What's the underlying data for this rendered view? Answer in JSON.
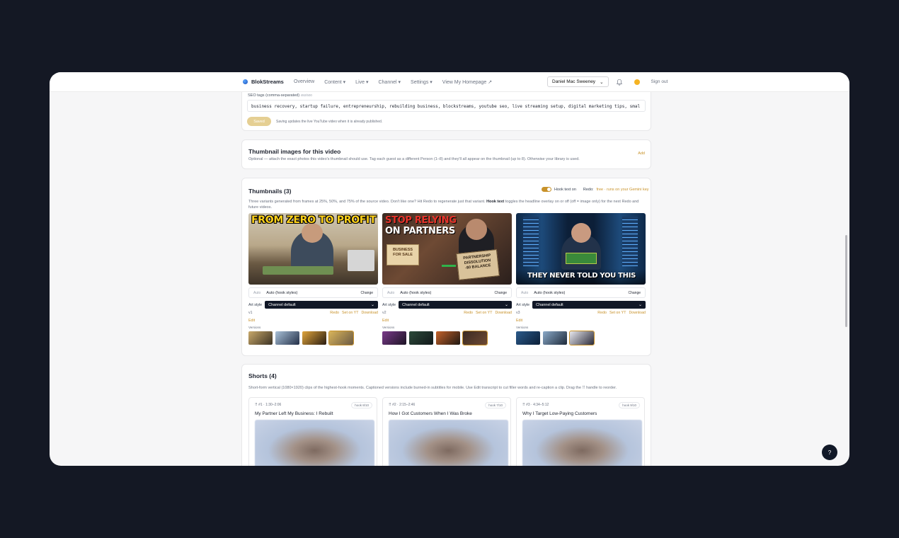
{
  "nav": {
    "brand": "BlokStreams",
    "links": [
      "Overview",
      "Content ▾",
      "Live ▾",
      "Channel ▾",
      "Settings ▾",
      "View My Homepage ↗"
    ],
    "user": "Daniel Mac Sweeney",
    "signout": "Sign out"
  },
  "seo": {
    "label": "SEO tags (comma-separated)",
    "count": "492/500",
    "value": "business recovery, startup failure, entrepreneurship, rebuilding business, blockstreams, youtube seo, live streaming setup, digital marketing tips, smal",
    "save": "Saved",
    "note": "Saving updates the live YouTube video when it is already published."
  },
  "thumbnail_images": {
    "title": "Thumbnail images for this video",
    "desc": "Optional — attach the exact photos this video's thumbnail should use. Tag each guest as a different Person (1–8) and they'll all appear on the thumbnail (up to 8). Otherwise your library is used.",
    "add": "Add"
  },
  "thumbnails": {
    "title": "Thumbnails (3)",
    "hook_toggle": "Hook text on",
    "redo_prefix": "Redo:",
    "redo_free": "free · runs on your Gemini key",
    "desc_a": "Three variants generated from frames at 25%, 50%, and 75% of the source video. Don't like one? Hit Redo to regenerate just that variant.",
    "desc_b": "Hook text",
    "desc_c": "toggles the headline overlay on or off (off = image only) for the next Redo and future videos.",
    "auto_label": "Auto",
    "auto_value": "Auto (hook styles)",
    "change": "Change",
    "art_label": "Art style",
    "art_value": "Channel default",
    "redo": "Redo",
    "set_yt": "Set on YT",
    "download": "Download",
    "edit": "Edit",
    "versions": "Versions",
    "items": [
      {
        "version": "v1",
        "hook": "FROM ZERO TO PROFIT"
      },
      {
        "version": "v2",
        "hook_line1": "STOP RELYING",
        "hook_line2": "ON PARTNERS",
        "sign1": "BUSINESS",
        "sign2": "FOR SALE",
        "sign3": "PARTNERSHIP",
        "sign4": "DISSOLUTION",
        "sign5": "-$0 BALANCE"
      },
      {
        "version": "v3",
        "hook": "THEY NEVER TOLD YOU THIS"
      }
    ]
  },
  "shorts": {
    "title": "Shorts (4)",
    "desc": "Short-form vertical (1080×1920) clips of the highest-hook moments. Captioned versions include burned-in subtitles for mobile. Use Edit transcript to cut filler words and re-caption a clip. Drag the ⠿ handle to reorder.",
    "items": [
      {
        "meta": "#1 · 1:30–2:06",
        "hook": "hook 8/10",
        "title": "My Partner Left My Business: I Rebuilt"
      },
      {
        "meta": "#2 · 2:15–2:46",
        "hook": "hook 7/10",
        "title": "How I Got Customers When I Was Broke"
      },
      {
        "meta": "#3 · 4:34–5:12",
        "hook": "hook 9/10",
        "title": "Why I Target Low-Paying Customers"
      }
    ]
  },
  "help": "?"
}
